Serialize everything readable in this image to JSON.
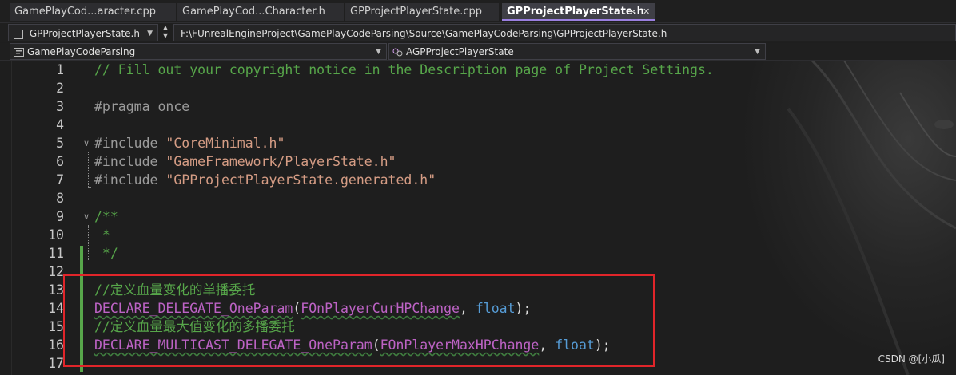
{
  "tabs": [
    {
      "label": "GamePlayCod...aracter.cpp",
      "active": false
    },
    {
      "label": "GamePlayCod...Character.h",
      "active": false
    },
    {
      "label": "GPProjectPlayerState.cpp",
      "active": false
    },
    {
      "label": "GPProjectPlayerState.h",
      "active": true
    }
  ],
  "tab_buttons": {
    "pin": "⊸",
    "close": "✕"
  },
  "nav": {
    "file_dropdown": "GPProjectPlayerState.h",
    "path": "F:\\FUnrealEngineProject\\GamePlayCodeParsing\\Source\\GamePlayCodeParsing\\GPProjectPlayerState.h",
    "project_scope": "GamePlayCodeParsing",
    "member_scope": "AGPProjectPlayerState"
  },
  "editor": {
    "lines": [
      {
        "n": "1",
        "tokens": [
          {
            "t": "// Fill out your copyright notice in the Description page of Project Settings.",
            "c": "cmt"
          }
        ]
      },
      {
        "n": "2",
        "tokens": []
      },
      {
        "n": "3",
        "tokens": [
          {
            "t": "#pragma once",
            "c": "pp"
          }
        ]
      },
      {
        "n": "4",
        "tokens": []
      },
      {
        "n": "5",
        "tokens": [
          {
            "t": "#include ",
            "c": "pp"
          },
          {
            "t": "\"CoreMinimal.h\"",
            "c": "str"
          }
        ]
      },
      {
        "n": "6",
        "tokens": [
          {
            "t": "#include ",
            "c": "pp"
          },
          {
            "t": "\"GameFramework/PlayerState.h\"",
            "c": "str"
          }
        ]
      },
      {
        "n": "7",
        "tokens": [
          {
            "t": "#include ",
            "c": "pp"
          },
          {
            "t": "\"GPProjectPlayerState.generated.h\"",
            "c": "str"
          }
        ]
      },
      {
        "n": "8",
        "tokens": []
      },
      {
        "n": "9",
        "tokens": [
          {
            "t": "/**",
            "c": "cmt"
          }
        ]
      },
      {
        "n": "10",
        "tokens": [
          {
            "t": " *",
            "c": "cmt"
          }
        ]
      },
      {
        "n": "11",
        "tokens": [
          {
            "t": " */",
            "c": "cmt"
          }
        ]
      },
      {
        "n": "12",
        "tokens": []
      },
      {
        "n": "13",
        "tokens": [
          {
            "t": "//定义血量变化的单播委托",
            "c": "cmt"
          }
        ]
      },
      {
        "n": "14",
        "tokens": [
          {
            "t": "DECLARE_DELEGATE_OneParam",
            "c": "mac"
          },
          {
            "t": "(",
            "c": "id"
          },
          {
            "t": "FOnPlayerCurHPChange",
            "c": "mac"
          },
          {
            "t": ", ",
            "c": "id"
          },
          {
            "t": "float",
            "c": "kw"
          },
          {
            "t": ");",
            "c": "id"
          }
        ]
      },
      {
        "n": "15",
        "tokens": [
          {
            "t": "//定义血量最大值变化的多播委托",
            "c": "cmt"
          }
        ]
      },
      {
        "n": "16",
        "tokens": [
          {
            "t": "DECLARE_MULTICAST_DELEGATE_OneParam",
            "c": "mac"
          },
          {
            "t": "(",
            "c": "id"
          },
          {
            "t": "FOnPlayerMaxHPChange",
            "c": "mac"
          },
          {
            "t": ", ",
            "c": "id"
          },
          {
            "t": "float",
            "c": "kw"
          },
          {
            "t": ");",
            "c": "id"
          }
        ]
      },
      {
        "n": "17",
        "tokens": []
      }
    ]
  },
  "watermark": "CSDN @[小瓜]",
  "colors": {
    "comment": "#57a64a",
    "string": "#d69d85",
    "macro": "#bd63c5",
    "keyword": "#569cd6",
    "highlight_box": "#e0252a",
    "change_bar": "#57a64a"
  }
}
